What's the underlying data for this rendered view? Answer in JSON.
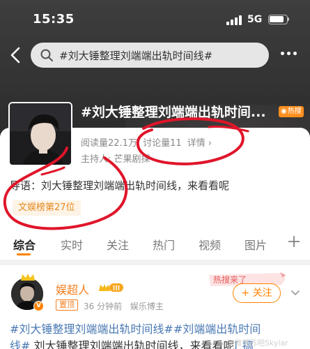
{
  "status_bar": {
    "time": "15:35",
    "network": "5G"
  },
  "search": {
    "query": "#刘大锤整理刘端端出轨时间线#"
  },
  "topic": {
    "title": "#刘大锤整理刘端端出轨时间...",
    "hot_badge": "热搜",
    "read_label": "阅读量22.1万",
    "discuss_label": "讨论量11",
    "details_label": "详情",
    "host_label": "主持人:",
    "host_name": "芒果剧探",
    "intro": "导语：刘大锤整理刘端端出轨时间线，来看看呢",
    "rank_tag": "文娱榜第27位"
  },
  "tabs": [
    "综合",
    "实时",
    "关注",
    "热门",
    "视频",
    "图片"
  ],
  "post": {
    "author": "娱超人",
    "level": "III",
    "pin_tag": "置顶",
    "time": "36 分钟前",
    "source": "娱乐博主",
    "hot_ribbon": "热搜来了",
    "follow_label": "+ 关注",
    "line1": "#刘大锤整理刘端端出轨时间线##刘端端出轨时间",
    "line2_tag": "线#",
    "line2_text": " 刘大锤整理刘端端出轨时间线，来看看呢",
    "line2_link": "[ 搞"
  },
  "watermark": "@微博苏吧Skylar",
  "colors": {
    "accent": "#ff8200",
    "link": "#4a79b3",
    "annotation": "#e0152a"
  }
}
